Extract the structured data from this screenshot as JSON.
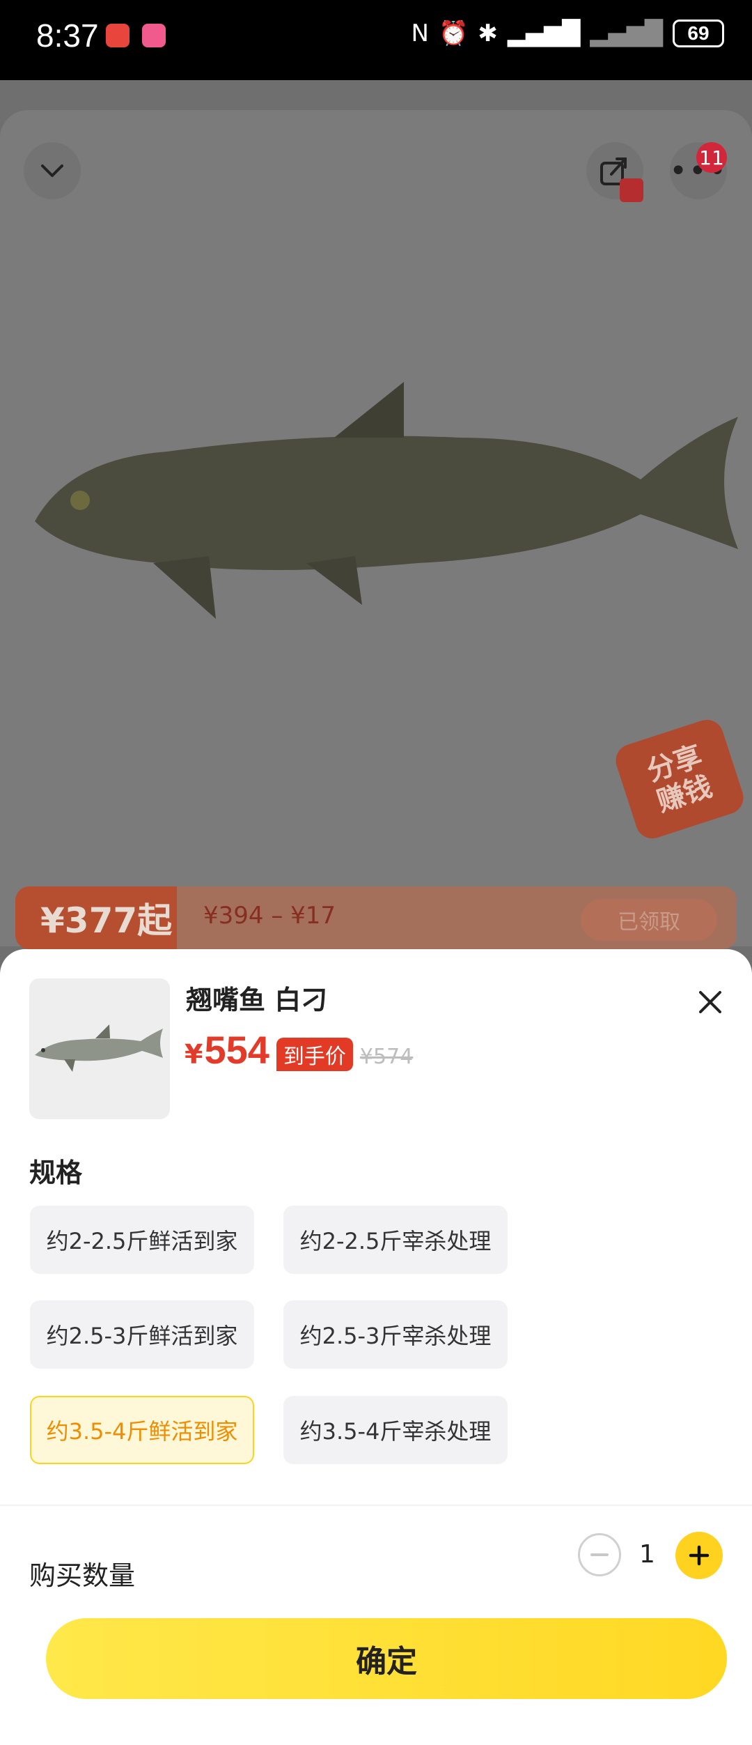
{
  "status_bar": {
    "time": "8:37",
    "battery": "69"
  },
  "header": {
    "notification_count": "11"
  },
  "share_fab": {
    "line1": "分享",
    "line2": "赚钱"
  },
  "promo": {
    "price": "¥377起",
    "range": "¥394 –  ¥17",
    "claimed_label": "已领取"
  },
  "product": {
    "name": "翘嘴鱼 白刁",
    "currency": "¥",
    "price": "554",
    "deal_tag": "到手价",
    "original_price": "¥574"
  },
  "spec": {
    "title": "规格",
    "options": [
      "约2-2.5斤鲜活到家",
      "约2-2.5斤宰杀处理",
      "约2.5-3斤鲜活到家",
      "约2.5-3斤宰杀处理",
      "约3.5-4斤鲜活到家",
      "约3.5-4斤宰杀处理"
    ],
    "selected_option": "约3.5-4斤鲜活到家"
  },
  "quantity": {
    "label": "购买数量",
    "value": "1"
  },
  "confirm_label": "确定",
  "colors": {
    "accent": "#ffd21f",
    "price": "#e33b2a",
    "selected_text": "#f08c00"
  }
}
